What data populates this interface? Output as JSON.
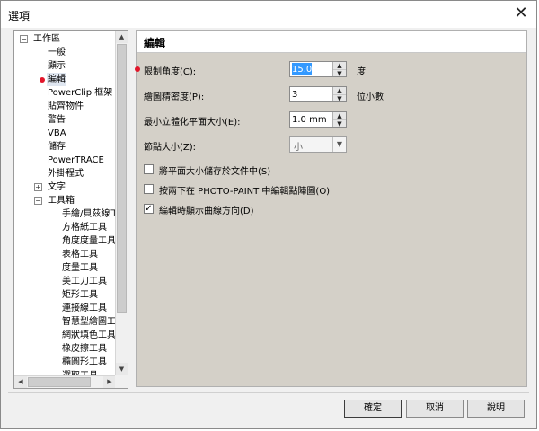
{
  "window": {
    "title": "選項",
    "close_glyph": "✕"
  },
  "tree": {
    "items": [
      {
        "label": "工作區",
        "depth": 0,
        "expander": "−"
      },
      {
        "label": "一般",
        "depth": 1
      },
      {
        "label": "顯示",
        "depth": 1
      },
      {
        "label": "編輯",
        "depth": 1,
        "selected": true
      },
      {
        "label": "PowerClip 框架",
        "depth": 1
      },
      {
        "label": "貼齊物件",
        "depth": 1
      },
      {
        "label": "警告",
        "depth": 1
      },
      {
        "label": "VBA",
        "depth": 1
      },
      {
        "label": "儲存",
        "depth": 1
      },
      {
        "label": "PowerTRACE",
        "depth": 1
      },
      {
        "label": "外掛程式",
        "depth": 1
      },
      {
        "label": "文字",
        "depth": 1,
        "expander": "+"
      },
      {
        "label": "工具箱",
        "depth": 1,
        "expander": "−"
      },
      {
        "label": "手繪/貝茲線工",
        "depth": 2
      },
      {
        "label": "方格紙工具",
        "depth": 2
      },
      {
        "label": "角度度量工具",
        "depth": 2
      },
      {
        "label": "表格工具",
        "depth": 2
      },
      {
        "label": "度量工具",
        "depth": 2
      },
      {
        "label": "美工刀工具",
        "depth": 2
      },
      {
        "label": "矩形工具",
        "depth": 2
      },
      {
        "label": "連接線工具",
        "depth": 2
      },
      {
        "label": "智慧型繪圖工",
        "depth": 2
      },
      {
        "label": "網狀填色工具",
        "depth": 2
      },
      {
        "label": "橡皮擦工具",
        "depth": 2
      },
      {
        "label": "橢圓形工具",
        "depth": 2
      },
      {
        "label": "選取工具",
        "depth": 2
      }
    ]
  },
  "page": {
    "title": "編輯",
    "fields": [
      {
        "label": "限制角度(C):",
        "value": "15.0",
        "unit": "度"
      },
      {
        "label": "繪圖精密度(P):",
        "value": "3",
        "unit": "位小數"
      },
      {
        "label": "最小立體化平面大小(E):",
        "value": "1.0 mm",
        "unit": ""
      }
    ],
    "node_size": {
      "label": "節點大小(Z):",
      "value": "小"
    },
    "checkboxes": [
      {
        "label": "將平面大小儲存於文件中(S)",
        "checked": false
      },
      {
        "label": "按兩下在 PHOTO-PAINT 中編輯點陣圖(O)",
        "checked": false
      },
      {
        "label": "編輯時顯示曲線方向(D)",
        "checked": true
      }
    ]
  },
  "buttons": {
    "ok": "確定",
    "cancel": "取消",
    "help": "說明"
  },
  "colors": {
    "marker": "#e2162a",
    "content_bg": "#d4d0c8",
    "selection": "#3399ff"
  }
}
